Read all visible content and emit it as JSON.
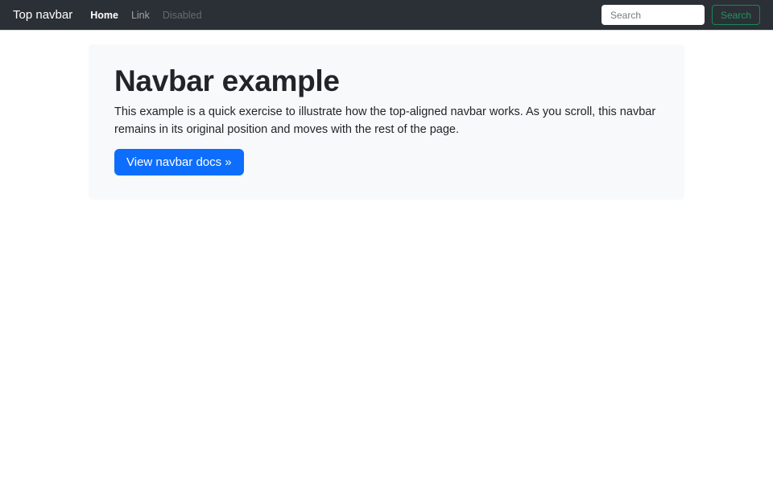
{
  "navbar": {
    "brand": "Top navbar",
    "items": [
      {
        "label": "Home",
        "state": "active"
      },
      {
        "label": "Link",
        "state": "default"
      },
      {
        "label": "Disabled",
        "state": "disabled"
      }
    ],
    "search": {
      "placeholder": "Search",
      "button_label": "Search"
    }
  },
  "content": {
    "title": "Navbar example",
    "description": "This example is a quick exercise to illustrate how the top-aligned navbar works. As you scroll, this navbar remains in its original position and moves with the rest of the page.",
    "cta_label": "View navbar docs »"
  },
  "colors": {
    "navbar_background": "#2b3036",
    "panel_background": "#f8f9fa",
    "primary": "#0d6efd",
    "success_outline": "#198754",
    "text": "#212529"
  }
}
